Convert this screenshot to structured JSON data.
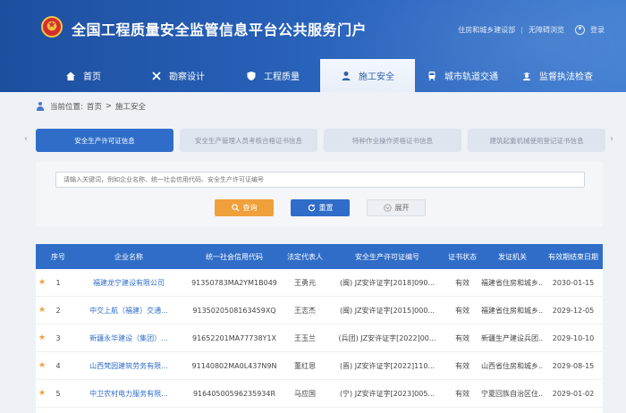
{
  "header": {
    "site_title": "全国工程质量安全监管信息平台公共服务门户",
    "links": [
      "住房和城乡建设部",
      "无障碍浏览",
      "登录"
    ]
  },
  "nav": [
    {
      "label": "首页",
      "icon": "home-icon"
    },
    {
      "label": "勘察设计",
      "icon": "tools-icon"
    },
    {
      "label": "工程质量",
      "icon": "shield-icon"
    },
    {
      "label": "施工安全",
      "icon": "worker-icon",
      "active": true
    },
    {
      "label": "城市轨道交通",
      "icon": "train-icon"
    },
    {
      "label": "监督执法检查",
      "icon": "inspector-icon"
    }
  ],
  "breadcrumb": {
    "prefix": "当前位置:",
    "home": "首页",
    "sep": ">",
    "current": "施工安全"
  },
  "cert_tabs": [
    {
      "label": "安全生产许可证信息",
      "active": true
    },
    {
      "label": "安全生产管理人员考核合格证书信息"
    },
    {
      "label": "特种作业操作资格证书信息"
    },
    {
      "label": "建筑起重机械使用登记证书信息"
    }
  ],
  "search": {
    "placeholder": "请输入关键词，例如企业名称、统一社会信用代码、安全生产许可证编号",
    "query_label": "查询",
    "reset_label": "重置",
    "expand_label": "展开"
  },
  "table": {
    "headers": [
      "序号",
      "企业名称",
      "统一社会信用代码",
      "法定代表人",
      "安全生产许可证编号",
      "证书状态",
      "发证机关",
      "有效期结束日期"
    ],
    "rows": [
      [
        "1",
        "福建龙宁建设有限公司",
        "91350783MA2YM1B049",
        "王勇元",
        "(闽) JZ安许证字[2018]090...",
        "有效",
        "福建省住房和城乡...",
        "2030-01-15"
      ],
      [
        "2",
        "中交上航（福建）交通...",
        "9135020508163459XQ",
        "王志杰",
        "(闽) JZ安许证字[2015]000...",
        "有效",
        "福建省住房和城乡...",
        "2029-12-05"
      ],
      [
        "3",
        "新疆永华建设（集团）...",
        "91652201MA77738Y1X",
        "王玉兰",
        "(兵团) JZ安许证字[2022]00...",
        "有效",
        "新疆生产建设兵团...",
        "2029-10-10"
      ],
      [
        "4",
        "山西梵园建筑劳务有限...",
        "91140802MA0L437N9N",
        "董红恩",
        "(晋) JZ安许证字[2022]110...",
        "有效",
        "山西省住房和城乡...",
        "2029-08-15"
      ],
      [
        "5",
        "中卫农村电力服务有限...",
        "91640500596235934R",
        "马应国",
        "(宁) JZ安许证字[2023]005...",
        "有效",
        "宁夏回族自治区住...",
        "2029-01-02"
      ]
    ]
  }
}
